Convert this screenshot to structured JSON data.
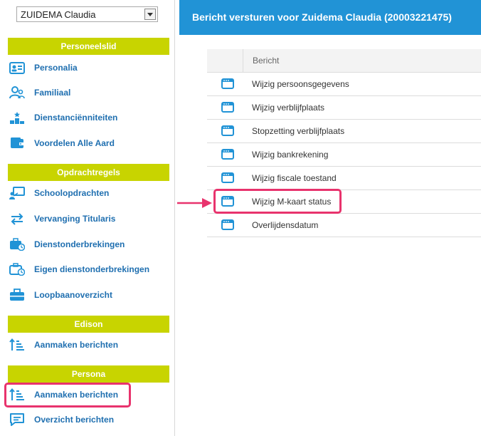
{
  "employee_select": {
    "value": "ZUIDEMA Claudia"
  },
  "sidebar": {
    "sections": [
      {
        "title": "Personeelslid"
      },
      {
        "title": "Opdrachtregels"
      },
      {
        "title": "Edison"
      },
      {
        "title": "Persona"
      }
    ],
    "personeelslid": [
      {
        "label": "Personalia",
        "icon": "id-card-icon"
      },
      {
        "label": "Familiaal",
        "icon": "family-icon"
      },
      {
        "label": "Dienstanciënniteiten",
        "icon": "podium-icon"
      },
      {
        "label": "Voordelen Alle Aard",
        "icon": "wallet-icon"
      }
    ],
    "opdrachtregels": [
      {
        "label": "Schoolopdrachten",
        "icon": "teacher-board-icon"
      },
      {
        "label": "Vervanging Titularis",
        "icon": "swap-arrows-icon"
      },
      {
        "label": "Dienstonderbrekingen",
        "icon": "briefcase-clock-icon"
      },
      {
        "label": "Eigen dienstonderbrekingen",
        "icon": "briefcase-clock-icon"
      },
      {
        "label": "Loopbaanoverzicht",
        "icon": "briefcase-icon"
      }
    ],
    "edison": [
      {
        "label": "Aanmaken berichten",
        "icon": "sort-list-icon"
      }
    ],
    "persona": [
      {
        "label": "Aanmaken berichten",
        "icon": "sort-list-icon"
      },
      {
        "label": "Overzicht berichten",
        "icon": "message-icon"
      }
    ]
  },
  "main": {
    "title": "Bericht versturen voor Zuidema Claudia (20003221475)",
    "table": {
      "column_header": "Bericht",
      "rows": [
        {
          "label": "Wijzig persoonsgegevens"
        },
        {
          "label": "Wijzig verblijfplaats"
        },
        {
          "label": "Stopzetting verblijfplaats"
        },
        {
          "label": "Wijzig bankrekening"
        },
        {
          "label": "Wijzig fiscale toestand"
        },
        {
          "label": "Wijzig M-kaart status"
        },
        {
          "label": "Overlijdensdatum"
        }
      ]
    }
  },
  "colors": {
    "accent_blue": "#2193d6",
    "section_green": "#c8d400",
    "link_blue": "#1f6fb0",
    "highlight_pink": "#e8336d"
  }
}
